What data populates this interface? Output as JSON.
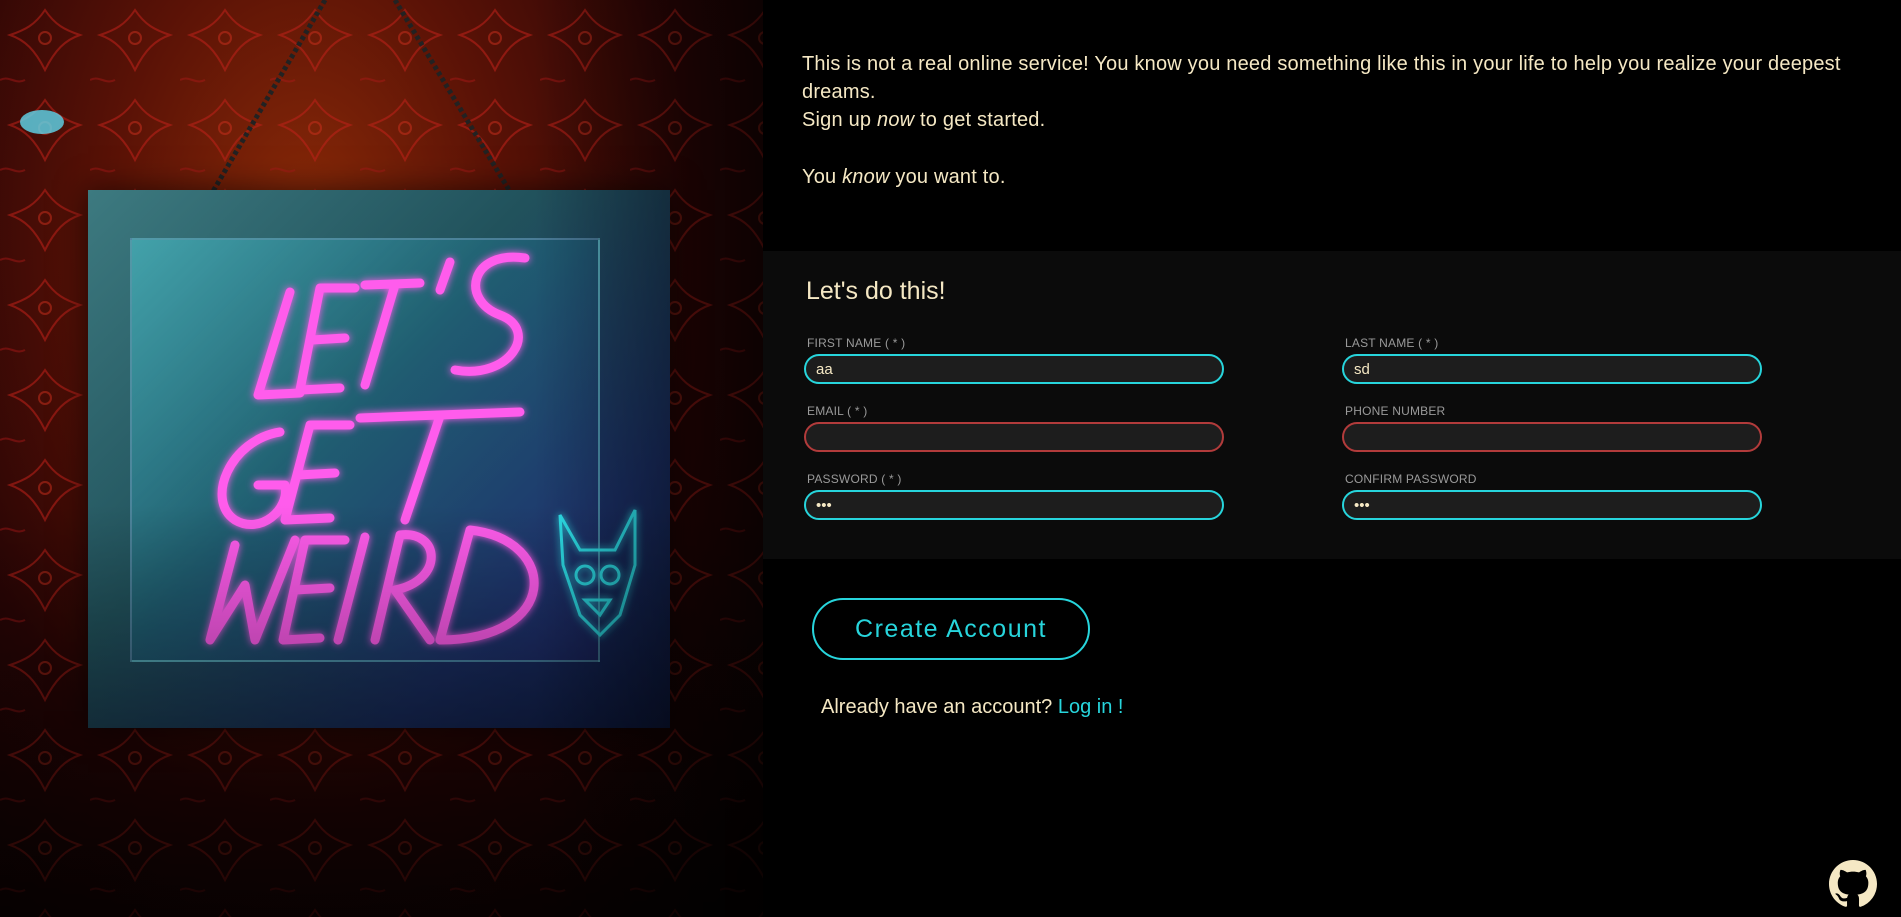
{
  "intro": {
    "line1": "This is not a real online service! You know you need something like this in your life to help you realize your deepest dreams.",
    "line2_prefix": "Sign up ",
    "line2_emphasis": "now",
    "line2_suffix": " to get started.",
    "line3_prefix": "You ",
    "line3_emphasis": "know",
    "line3_suffix": " you want to."
  },
  "hero": {
    "sign_text": [
      "LET'S",
      "GET",
      "WEIRD"
    ]
  },
  "form": {
    "title": "Let's do this!",
    "fields": {
      "first_name": {
        "label": "FIRST NAME ( * )",
        "value": "aa",
        "type": "text",
        "state": "valid"
      },
      "last_name": {
        "label": "LAST NAME ( * )",
        "value": "sd",
        "type": "text",
        "state": "valid"
      },
      "email": {
        "label": "EMAIL ( * )",
        "value": "",
        "type": "email",
        "state": "invalid"
      },
      "phone": {
        "label": "PHONE NUMBER",
        "value": "",
        "type": "tel",
        "state": "invalid"
      },
      "password": {
        "label": "PASSWORD ( * )",
        "value": "aaa",
        "type": "password",
        "state": "valid"
      },
      "confirm_password": {
        "label": "CONFIRM PASSWORD",
        "value": "aaa",
        "type": "password",
        "state": "valid"
      }
    }
  },
  "actions": {
    "create_account": "Create Account",
    "login_prompt": "Already have an account? ",
    "login_link": "Log in !"
  },
  "footer": {
    "github_icon": "github-icon"
  },
  "colors": {
    "background": "#000000",
    "panel": "#0b0b0b",
    "accent": "#27d5dc",
    "invalid": "#b23b3b",
    "text": "#f5e8c4",
    "label": "#9a9a9a",
    "neon_pink": "#ff4fe6"
  }
}
